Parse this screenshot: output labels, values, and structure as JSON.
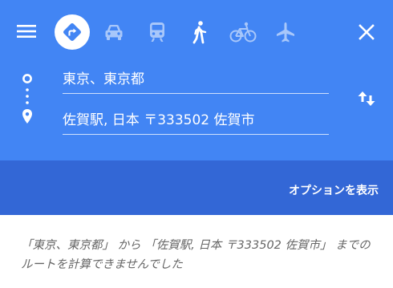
{
  "colors": {
    "header_bg": "#4285f4",
    "options_bar_bg": "#3367d6",
    "active_mode_icon": "#4285f4",
    "inactive_mode_icon": "#a8c7fa",
    "message_text": "#666666"
  },
  "header": {
    "icons": {
      "menu": "menu-icon",
      "close": "close-icon",
      "swap": "swap-vertical-icon",
      "origin": "origin-circle-icon",
      "destination": "location-pin-icon"
    },
    "travel_modes": [
      {
        "id": "best",
        "icon": "directions-diamond-icon",
        "selected": true
      },
      {
        "id": "driving",
        "icon": "car-icon",
        "selected": false
      },
      {
        "id": "transit",
        "icon": "train-icon",
        "selected": false
      },
      {
        "id": "walking",
        "icon": "walking-icon",
        "selected": false
      },
      {
        "id": "cycling",
        "icon": "bicycle-icon",
        "selected": false
      },
      {
        "id": "flights",
        "icon": "airplane-icon",
        "selected": false
      }
    ]
  },
  "route": {
    "origin": "東京、東京都",
    "destination": "佐賀駅, 日本 〒333502 佐賀市"
  },
  "options": {
    "show_options_label": "オプションを表示"
  },
  "result": {
    "message": "「東京、東京都」 から 「佐賀駅, 日本 〒333502 佐賀市」 までのルートを計算できませんでした"
  }
}
